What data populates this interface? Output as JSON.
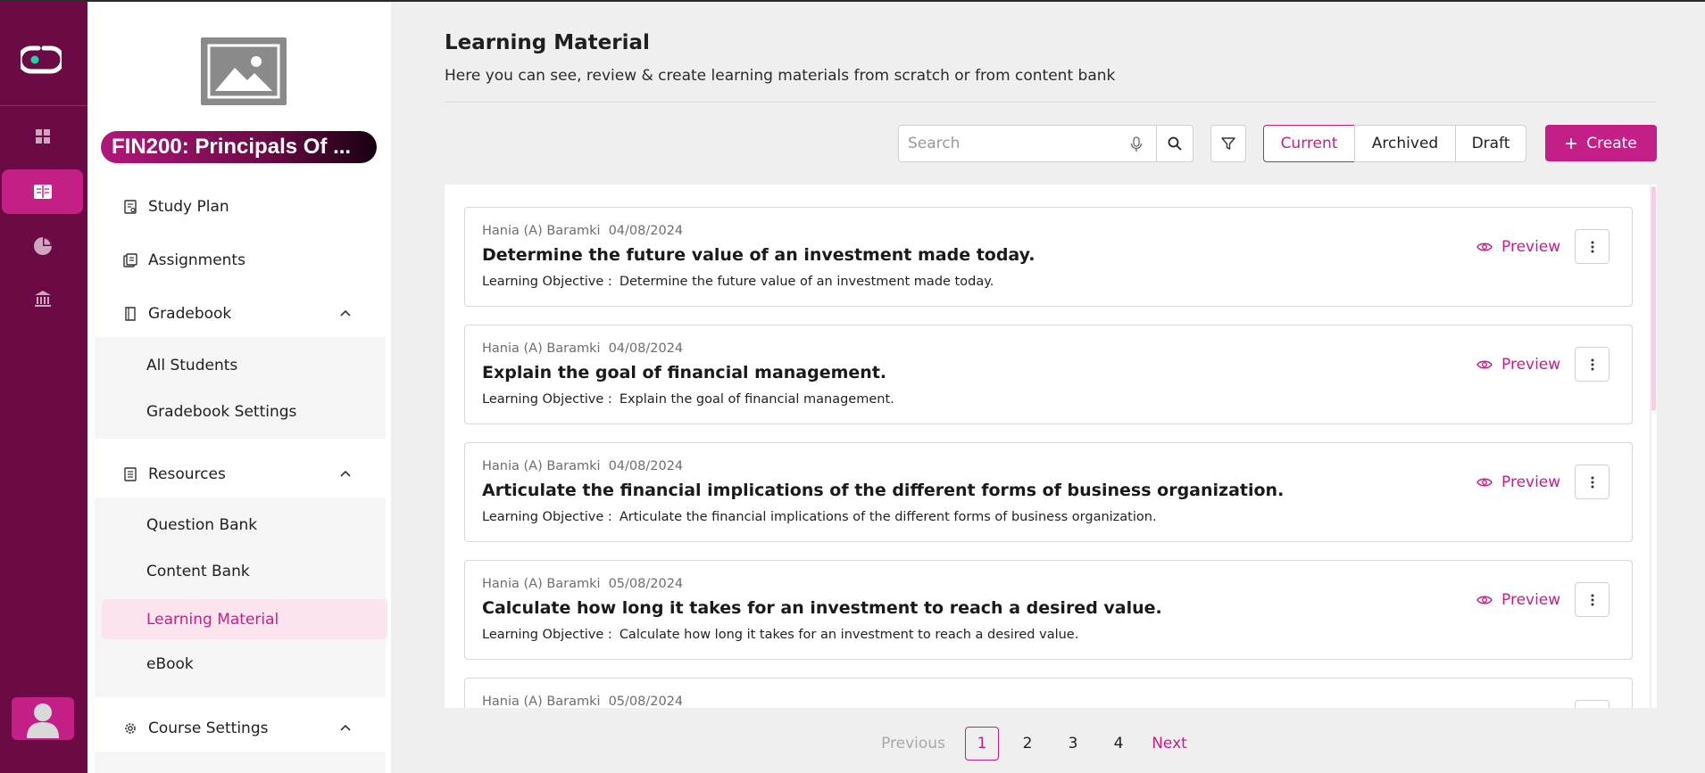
{
  "colors": {
    "brand": "#c41f86",
    "rail": "#6b0a45",
    "active_bg": "#fbe4ef"
  },
  "rail": {
    "items": [
      {
        "name": "dashboard",
        "icon": "grid-icon"
      },
      {
        "name": "learning",
        "icon": "book-icon",
        "active": true
      },
      {
        "name": "analytics",
        "icon": "pie-chart-icon"
      },
      {
        "name": "institution",
        "icon": "bank-icon"
      }
    ]
  },
  "sidebar": {
    "course_title": "FIN200: Principals Of ...",
    "nav": {
      "study_plan": "Study Plan",
      "assignments": "Assignments",
      "gradebook": "Gradebook",
      "resources": "Resources",
      "course_settings": "Course Settings"
    },
    "gradebook_sub": [
      "All Students",
      "Gradebook Settings"
    ],
    "resources_sub": [
      "Question Bank",
      "Content Bank",
      "Learning Material",
      "eBook"
    ],
    "active_item": "Learning Material"
  },
  "header": {
    "title": "Learning Material",
    "subtitle": "Here you can see, review & create learning materials from scratch or from content bank"
  },
  "toolbar": {
    "search_placeholder": "Search",
    "tabs": [
      "Current",
      "Archived",
      "Draft"
    ],
    "selected_tab": "Current",
    "create_label": "Create"
  },
  "objective_label": "Learning Objective :",
  "preview_label": "Preview",
  "materials": [
    {
      "author": "Hania (A) Baramki",
      "date": "04/08/2024",
      "title": "Determine the future value of an investment made today.",
      "objective": "Determine the future value of an investment made today."
    },
    {
      "author": "Hania (A) Baramki",
      "date": "04/08/2024",
      "title": "Explain the goal of financial management.",
      "objective": "Explain the goal of financial management."
    },
    {
      "author": "Hania (A) Baramki",
      "date": "04/08/2024",
      "title": "Articulate the financial implications of the different forms of business organization.",
      "objective": "Articulate the financial implications of the different forms of business organization."
    },
    {
      "author": "Hania (A) Baramki",
      "date": "05/08/2024",
      "title": "Calculate how long it takes for an investment to reach a desired value.",
      "objective": "Calculate how long it takes for an investment to reach a desired value."
    },
    {
      "author": "Hania (A) Baramki",
      "date": "05/08/2024"
    }
  ],
  "pagination": {
    "previous": "Previous",
    "pages": [
      "1",
      "2",
      "3",
      "4"
    ],
    "current": "1",
    "next": "Next"
  }
}
